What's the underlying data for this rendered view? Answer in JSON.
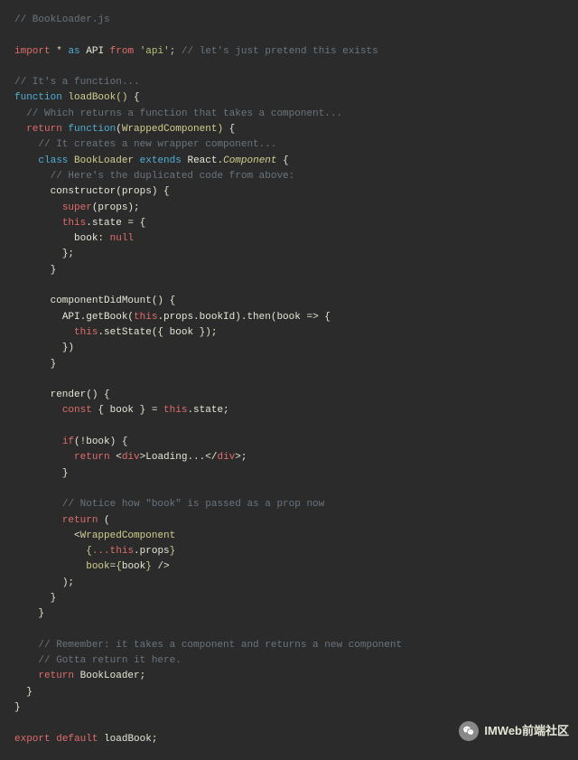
{
  "footer": {
    "label": "IMWeb前端社区"
  },
  "code": {
    "l1": "// BookLoader.js",
    "l3_import": "import",
    "l3_star": "*",
    "l3_as": "as",
    "l3_api": "API",
    "l3_from": "from",
    "l3_str": "'api'",
    "l3_semi": ";",
    "l3_c": "// let's just pretend this exists",
    "l5": "// It's a function...",
    "l6_fn": "function",
    "l6_name": "loadBook",
    "l6_p": "()",
    "l6_b": " {",
    "l7": "// Which returns a function that takes a component...",
    "l8_ret": "return",
    "l8_fn": "function",
    "l8_p1": "(",
    "l8_arg": "WrappedComponent",
    "l8_p2": ")",
    "l8_b": " {",
    "l9": "// It creates a new wrapper component...",
    "l10_class": "class",
    "l10_name": "BookLoader",
    "l10_ext": "extends",
    "l10_react": "React.",
    "l10_comp": "Component",
    "l10_b": " {",
    "l11": "// Here's the duplicated code from above:",
    "l12_ctor": "constructor(props) {",
    "l13_super": "super",
    "l13_rest": "(props);",
    "l14_this": "this",
    "l14_rest": ".state = {",
    "l15_book": "book: ",
    "l15_null": "null",
    "l16": "};",
    "l17": "}",
    "l19": "componentDidMount() {",
    "l20_a": "API.getBook(",
    "l20_this": "this",
    "l20_b": ".props.bookId).then(book => {",
    "l21_this": "this",
    "l21_rest": ".setState({ book });",
    "l22": "})",
    "l23": "}",
    "l25": "render() {",
    "l26_const": "const",
    "l26_mid": " { book } = ",
    "l26_this": "this",
    "l26_end": ".state;",
    "l28_if": "if",
    "l28_rest": "(!book) {",
    "l29_ret": "return",
    "l29_lt1": " <",
    "l29_div1": "div",
    "l29_gt1": ">",
    "l29_txt": "Loading...",
    "l29_lt2": "</",
    "l29_div2": "div",
    "l29_gt2": ">;",
    "l30": "}",
    "l32": "// Notice how \"book\" is passed as a prop now",
    "l33_ret": "return",
    "l33_p": " (",
    "l34_lt": "<",
    "l34_tag": "WrappedComponent",
    "l35_b1": "{",
    "l35_spread": "...",
    "l35_this": "this",
    "l35_props": ".props",
    "l35_b2": "}",
    "l36_attr": "book",
    "l36_eq": "=",
    "l36_b1": "{",
    "l36_val": "book",
    "l36_b2": "}",
    "l36_end": " />",
    "l37": ");",
    "l38": "}",
    "l39": "}",
    "l41": "// Remember: it takes a component and returns a new component",
    "l42": "// Gotta return it here.",
    "l43_ret": "return",
    "l43_val": " BookLoader;",
    "l44": "}",
    "l45": "}",
    "l47_exp": "export",
    "l47_def": "default",
    "l47_val": " loadBook;"
  }
}
